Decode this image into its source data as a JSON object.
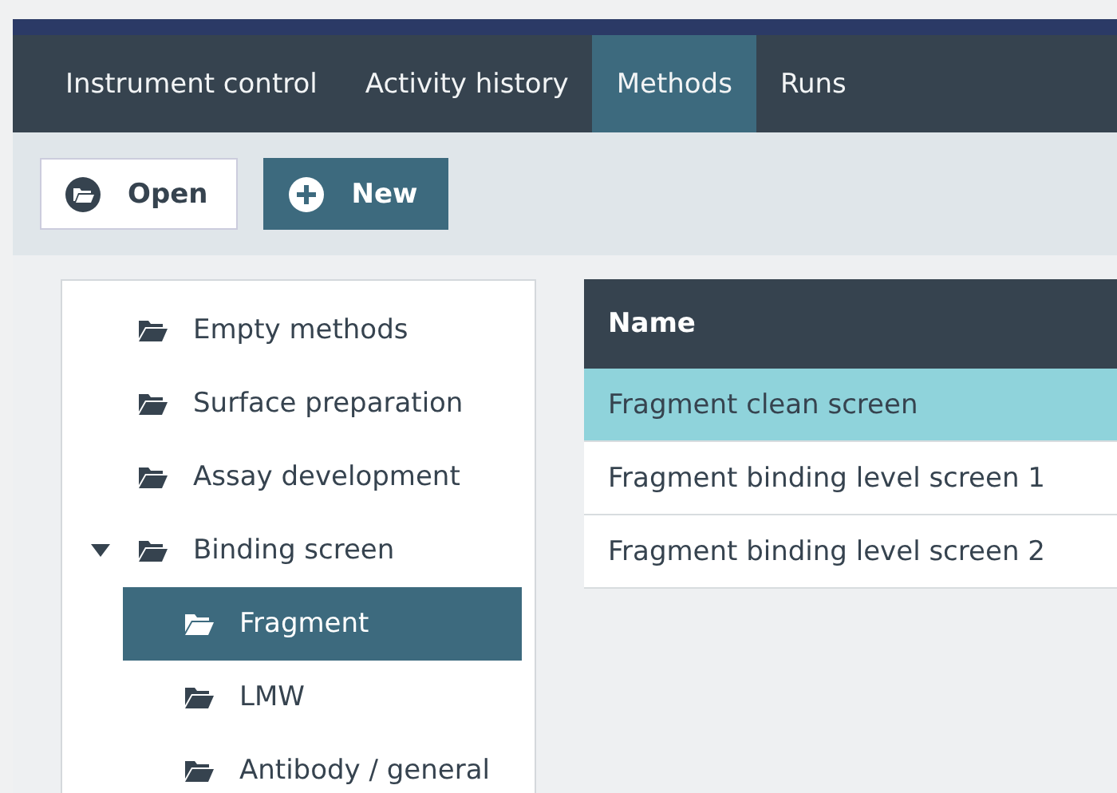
{
  "tabs": [
    {
      "label": "Instrument control",
      "selected": false
    },
    {
      "label": "Activity history",
      "selected": false
    },
    {
      "label": "Methods",
      "selected": true
    },
    {
      "label": "Runs",
      "selected": false
    }
  ],
  "toolbar": [
    {
      "label": "Open",
      "kind": "open"
    },
    {
      "label": "New",
      "kind": "new"
    }
  ],
  "tree": [
    {
      "label": "Empty methods",
      "selected": false
    },
    {
      "label": "Surface preparation",
      "selected": false
    },
    {
      "label": "Assay development",
      "selected": false
    },
    {
      "label": "Binding screen",
      "selected": false,
      "expanded": true,
      "children": [
        {
          "label": "Fragment",
          "selected": true
        },
        {
          "label": "LMW",
          "selected": false
        },
        {
          "label": "Antibody / general",
          "selected": false
        }
      ]
    }
  ],
  "table": {
    "columns": [
      "Name"
    ],
    "rows": [
      {
        "name": "Fragment clean screen",
        "selected": true
      },
      {
        "name": "Fragment binding level screen 1",
        "selected": false
      },
      {
        "name": "Fragment binding level screen 2",
        "selected": false
      }
    ]
  }
}
